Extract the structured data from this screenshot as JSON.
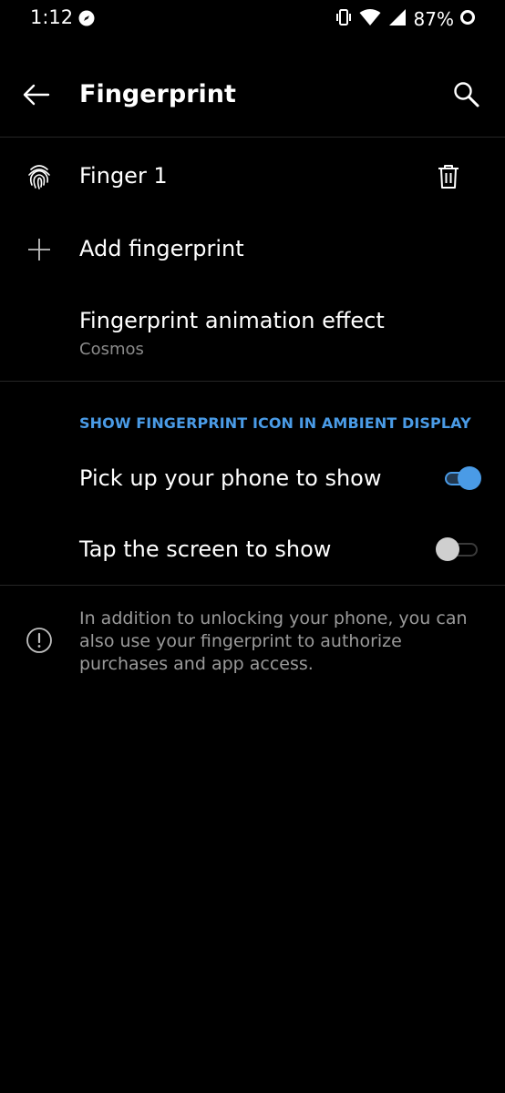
{
  "status_bar": {
    "time": "1:12",
    "battery_percent": "87%",
    "icons": [
      "app-notification-icon",
      "vibrate-icon",
      "wifi-icon",
      "cell-signal-icon",
      "battery-ring-icon"
    ]
  },
  "header": {
    "title": "Fingerprint",
    "back_icon": "arrow-left-icon",
    "search_icon": "search-icon"
  },
  "fingerprints": [
    {
      "label": "Finger 1",
      "icon": "fingerprint-icon",
      "action_icon": "trash-icon"
    }
  ],
  "add_fingerprint": {
    "label": "Add fingerprint",
    "icon": "plus-icon"
  },
  "animation_effect": {
    "label": "Fingerprint animation effect",
    "value": "Cosmos"
  },
  "ambient_section": {
    "header": "SHOW FINGERPRINT ICON IN AMBIENT DISPLAY",
    "options": [
      {
        "label": "Pick up your phone to show",
        "enabled": true
      },
      {
        "label": "Tap the screen to show",
        "enabled": false
      }
    ]
  },
  "info": {
    "icon": "info-icon",
    "text": "In addition to unlocking your phone, you can also use your fingerprint to authorize purchases and app access."
  },
  "colors": {
    "background": "#000000",
    "accent": "#4a9be6",
    "primary_text": "#ffffff",
    "secondary_text": "#8a8a8a"
  }
}
